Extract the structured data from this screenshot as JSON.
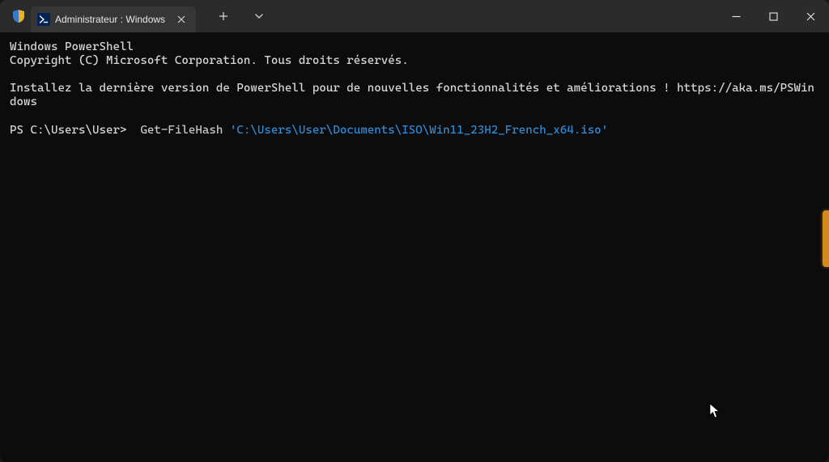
{
  "tab": {
    "title": "Administrateur : Windows Po"
  },
  "terminal": {
    "banner_line1": "Windows PowerShell",
    "banner_line2": "Copyright (C) Microsoft Corporation. Tous droits réservés.",
    "install_msg": "Installez la dernière version de PowerShell pour de nouvelles fonctionnalités et améliorations ! https://aka.ms/PSWindows",
    "prompt": "PS C:\\Users\\User> ",
    "command": "Get-FileHash",
    "argument": "'C:\\Users\\User\\Documents\\ISO\\Win11_23H2_French_x64.iso'"
  }
}
